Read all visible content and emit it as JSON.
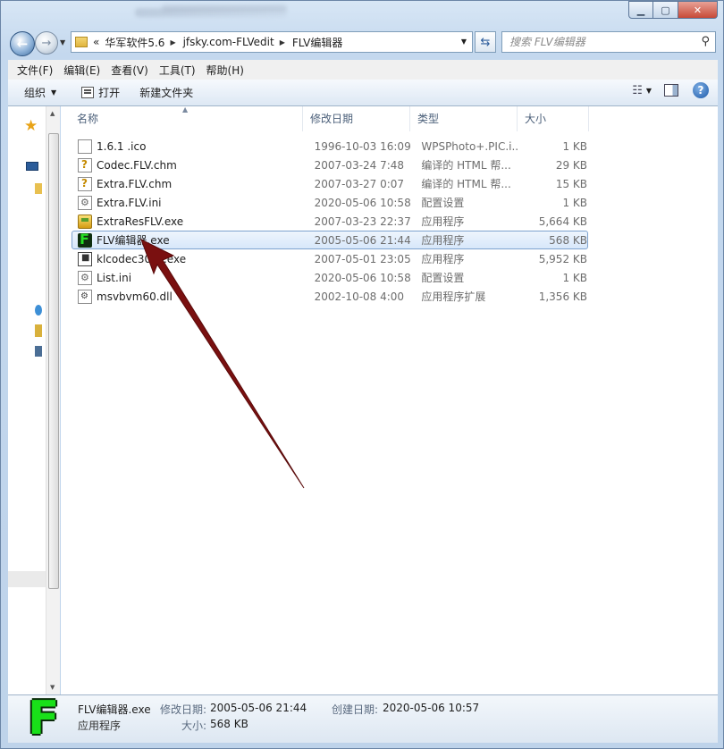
{
  "address": {
    "overflow": "«",
    "crumbs": [
      "华军软件5.6",
      "jfsky.com-FLVedit",
      "FLV编辑器"
    ]
  },
  "search": {
    "placeholder": "搜索 FLV编辑器"
  },
  "menu": [
    "文件(F)",
    "编辑(E)",
    "查看(V)",
    "工具(T)",
    "帮助(H)"
  ],
  "toolbar": {
    "organize": "组织",
    "open": "打开",
    "new_folder": "新建文件夹"
  },
  "columns": {
    "name": "名称",
    "date": "修改日期",
    "type": "类型",
    "size": "大小"
  },
  "files": [
    {
      "name": "1.6.1     .ico",
      "date": "1996-10-03 16:09",
      "type": "WPSPhoto+.PIC.i...",
      "size": "1 KB",
      "icon": "ico-file-icon"
    },
    {
      "name": "Codec.FLV.chm",
      "date": "2007-03-24 7:48",
      "type": "编译的 HTML 帮...",
      "size": "29 KB",
      "icon": "chm-help-icon"
    },
    {
      "name": "Extra.FLV.chm",
      "date": "2007-03-27 0:07",
      "type": "编译的 HTML 帮...",
      "size": "15 KB",
      "icon": "chm-help-icon"
    },
    {
      "name": "Extra.FLV.ini",
      "date": "2020-05-06 10:58",
      "type": "配置设置",
      "size": "1 KB",
      "icon": "ini-settings-icon"
    },
    {
      "name": "ExtraResFLV.exe",
      "date": "2007-03-23 22:37",
      "type": "应用程序",
      "size": "5,664 KB",
      "icon": "exe-app-icon"
    },
    {
      "name": "FLV编辑器.exe",
      "date": "2005-05-06 21:44",
      "type": "应用程序",
      "size": "568 KB",
      "icon": "flv-editor-icon"
    },
    {
      "name": "klcodec305s.exe",
      "date": "2007-05-01 23:05",
      "type": "应用程序",
      "size": "5,952 KB",
      "icon": "klcodec-icon"
    },
    {
      "name": "List.ini",
      "date": "2020-05-06 10:58",
      "type": "配置设置",
      "size": "1 KB",
      "icon": "ini-settings-icon"
    },
    {
      "name": "msvbvm60.dll",
      "date": "2002-10-08 4:00",
      "type": "应用程序扩展",
      "size": "1,356 KB",
      "icon": "dll-icon"
    }
  ],
  "selected_index": 5,
  "details": {
    "name": "FLV编辑器.exe",
    "type": "应用程序",
    "modified_label": "修改日期:",
    "modified_value": "2005-05-06 21:44",
    "size_label": "大小:",
    "size_value": "568 KB",
    "created_label": "创建日期:",
    "created_value": "2020-05-06 10:57"
  },
  "colors": {
    "arrow": "#7a1010",
    "selection_border": "#7da2ce",
    "flv_green": "#22e022"
  }
}
